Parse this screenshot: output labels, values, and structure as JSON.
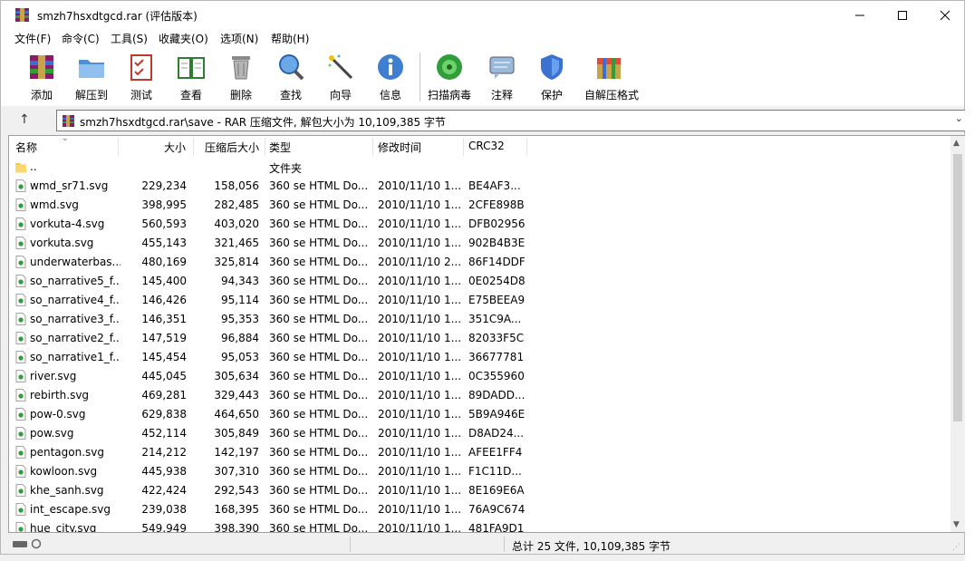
{
  "window": {
    "title": "smzh7hsxdtgcd.rar (评估版本)"
  },
  "menu": [
    "文件(F)",
    "命令(C)",
    "工具(S)",
    "收藏夹(O)",
    "选项(N)",
    "帮助(H)"
  ],
  "toolbar": {
    "add": "添加",
    "extract": "解压到",
    "test": "测试",
    "view": "查看",
    "delete": "删除",
    "find": "查找",
    "wizard": "向导",
    "info": "信息",
    "scan": "扫描病毒",
    "comment": "注释",
    "protect": "保护",
    "sfx": "自解压格式"
  },
  "address": {
    "path": "smzh7hsxdtgcd.rar\\save - RAR 压缩文件, 解包大小为 10,109,385 字节"
  },
  "columns": {
    "name": "名称",
    "size": "大小",
    "packed": "压缩后大小",
    "type": "类型",
    "modified": "修改时间",
    "crc": "CRC32"
  },
  "rows": [
    {
      "name": "..",
      "size": "",
      "packed": "",
      "type": "文件夹",
      "modified": "",
      "crc": "",
      "folder": true
    },
    {
      "name": "wmd_sr71.svg",
      "size": "229,234",
      "packed": "158,056",
      "type": "360 se HTML Do...",
      "modified": "2010/11/10 1...",
      "crc": "BE4AF3..."
    },
    {
      "name": "wmd.svg",
      "size": "398,995",
      "packed": "282,485",
      "type": "360 se HTML Do...",
      "modified": "2010/11/10 1...",
      "crc": "2CFE898B"
    },
    {
      "name": "vorkuta-4.svg",
      "size": "560,593",
      "packed": "403,020",
      "type": "360 se HTML Do...",
      "modified": "2010/11/10 1...",
      "crc": "DFB02956"
    },
    {
      "name": "vorkuta.svg",
      "size": "455,143",
      "packed": "321,465",
      "type": "360 se HTML Do...",
      "modified": "2010/11/10 1...",
      "crc": "902B4B3E"
    },
    {
      "name": "underwaterbas...",
      "size": "480,169",
      "packed": "325,814",
      "type": "360 se HTML Do...",
      "modified": "2010/11/10 2...",
      "crc": "86F14DDF"
    },
    {
      "name": "so_narrative5_f...",
      "size": "145,400",
      "packed": "94,343",
      "type": "360 se HTML Do...",
      "modified": "2010/11/10 1...",
      "crc": "0E0254D8"
    },
    {
      "name": "so_narrative4_f...",
      "size": "146,426",
      "packed": "95,114",
      "type": "360 se HTML Do...",
      "modified": "2010/11/10 1...",
      "crc": "E75BEEA9"
    },
    {
      "name": "so_narrative3_f...",
      "size": "146,351",
      "packed": "95,353",
      "type": "360 se HTML Do...",
      "modified": "2010/11/10 1...",
      "crc": "351C9A..."
    },
    {
      "name": "so_narrative2_f...",
      "size": "147,519",
      "packed": "96,884",
      "type": "360 se HTML Do...",
      "modified": "2010/11/10 1...",
      "crc": "82033F5C"
    },
    {
      "name": "so_narrative1_f...",
      "size": "145,454",
      "packed": "95,053",
      "type": "360 se HTML Do...",
      "modified": "2010/11/10 1...",
      "crc": "36677781"
    },
    {
      "name": "river.svg",
      "size": "445,045",
      "packed": "305,634",
      "type": "360 se HTML Do...",
      "modified": "2010/11/10 1...",
      "crc": "0C355960"
    },
    {
      "name": "rebirth.svg",
      "size": "469,281",
      "packed": "329,443",
      "type": "360 se HTML Do...",
      "modified": "2010/11/10 1...",
      "crc": "89DADD..."
    },
    {
      "name": "pow-0.svg",
      "size": "629,838",
      "packed": "464,650",
      "type": "360 se HTML Do...",
      "modified": "2010/11/10 1...",
      "crc": "5B9A946E"
    },
    {
      "name": "pow.svg",
      "size": "452,114",
      "packed": "305,849",
      "type": "360 se HTML Do...",
      "modified": "2010/11/10 1...",
      "crc": "D8AD24..."
    },
    {
      "name": "pentagon.svg",
      "size": "214,212",
      "packed": "142,197",
      "type": "360 se HTML Do...",
      "modified": "2010/11/10 1...",
      "crc": "AFEE1FF4"
    },
    {
      "name": "kowloon.svg",
      "size": "445,938",
      "packed": "307,310",
      "type": "360 se HTML Do...",
      "modified": "2010/11/10 1...",
      "crc": "F1C11D..."
    },
    {
      "name": "khe_sanh.svg",
      "size": "422,424",
      "packed": "292,543",
      "type": "360 se HTML Do...",
      "modified": "2010/11/10 1...",
      "crc": "8E169E6A"
    },
    {
      "name": "int_escape.svg",
      "size": "239,038",
      "packed": "168,395",
      "type": "360 se HTML Do...",
      "modified": "2010/11/10 1...",
      "crc": "76A9C674"
    },
    {
      "name": "hue_city.svg",
      "size": "549,949",
      "packed": "398,390",
      "type": "360 se HTML Do...",
      "modified": "2010/11/10 1...",
      "crc": "481FA9D1"
    }
  ],
  "status": {
    "summary": "总计 25 文件, 10,109,385 字节"
  }
}
